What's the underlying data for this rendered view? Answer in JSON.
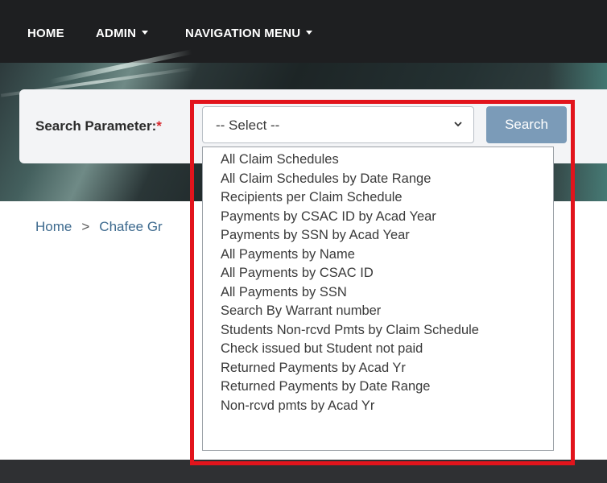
{
  "nav": {
    "home": "HOME",
    "admin": "ADMIN",
    "navigation_menu": "NAVIGATION MENU"
  },
  "search": {
    "label": "Search Parameter:",
    "required_mark": "*",
    "select_value": "-- Select --",
    "button_label": "Search"
  },
  "breadcrumb": {
    "home": "Home",
    "separator": ">",
    "current": "Chafee Gr"
  },
  "dropdown": {
    "options": [
      "All Claim Schedules",
      "All Claim Schedules by Date Range",
      "Recipients per Claim Schedule",
      "Payments by CSAC ID by Acad Year",
      "Payments by SSN by Acad Year",
      "All Payments by Name",
      "All Payments by CSAC ID",
      "All Payments by SSN",
      "Search By Warrant number",
      "Students Non-rcvd Pmts by Claim Schedule",
      "Check issued but Student not paid",
      "Returned Payments by Acad Yr",
      "Returned Payments by Date Range",
      "Non-rcvd pmts by Acad Yr"
    ]
  },
  "colors": {
    "nav_bg": "#1e1f21",
    "search_button": "#7b9bb8",
    "link": "#3d6a8e",
    "highlight": "#e2141c",
    "required": "#d7262b"
  }
}
